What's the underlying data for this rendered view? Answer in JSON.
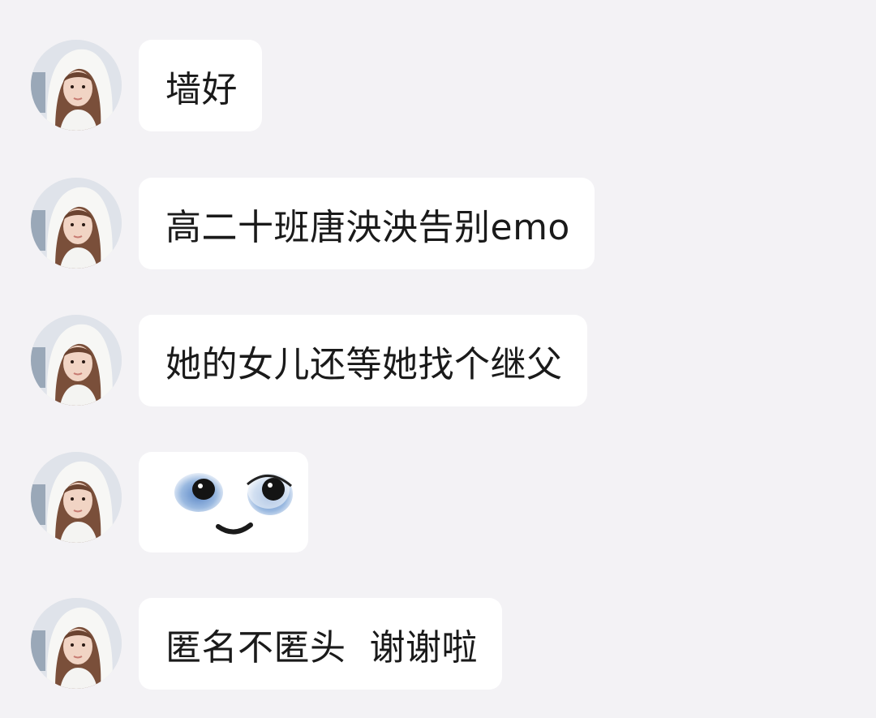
{
  "messages": [
    {
      "type": "text",
      "text": "墙好"
    },
    {
      "type": "text",
      "text": "高二十班唐泱泱告别emo"
    },
    {
      "type": "text",
      "text": "她的女儿还等她找个继父"
    },
    {
      "type": "sticker",
      "sticker": "crying-face-emoji-sticker"
    },
    {
      "type": "text",
      "text": "匿名不匿头  谢谢啦"
    }
  ],
  "avatar": {
    "icon": "hooded-girl-avatar"
  },
  "colors": {
    "background": "#f3f2f5",
    "bubble": "#ffffff",
    "text": "#1a1a1a"
  }
}
